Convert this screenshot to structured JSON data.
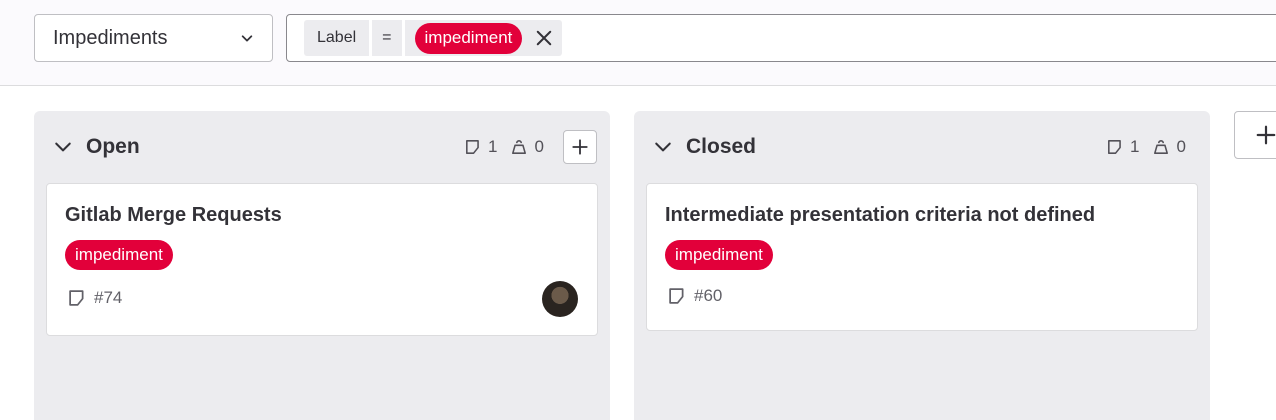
{
  "filter": {
    "board_name": "Impediments",
    "token_key": "Label",
    "token_operator": "=",
    "token_value": "impediment"
  },
  "colors": {
    "label_red": "#e2003a",
    "column_bg": "#ececef"
  },
  "columns": [
    {
      "title": "Open",
      "issue_count": "1",
      "weight": "0",
      "cards": [
        {
          "title": "Gitlab Merge Requests",
          "label": "impediment",
          "ref": "#74",
          "has_avatar": true
        }
      ]
    },
    {
      "title": "Closed",
      "issue_count": "1",
      "weight": "0",
      "cards": [
        {
          "title": "Intermediate presentation criteria not defined",
          "label": "impediment",
          "ref": "#60",
          "has_avatar": false
        }
      ]
    }
  ],
  "icons": {
    "chevron": "chevron-down-icon",
    "issues": "issue-icon",
    "weight": "weight-icon",
    "add": "plus-icon",
    "close": "close-icon"
  }
}
